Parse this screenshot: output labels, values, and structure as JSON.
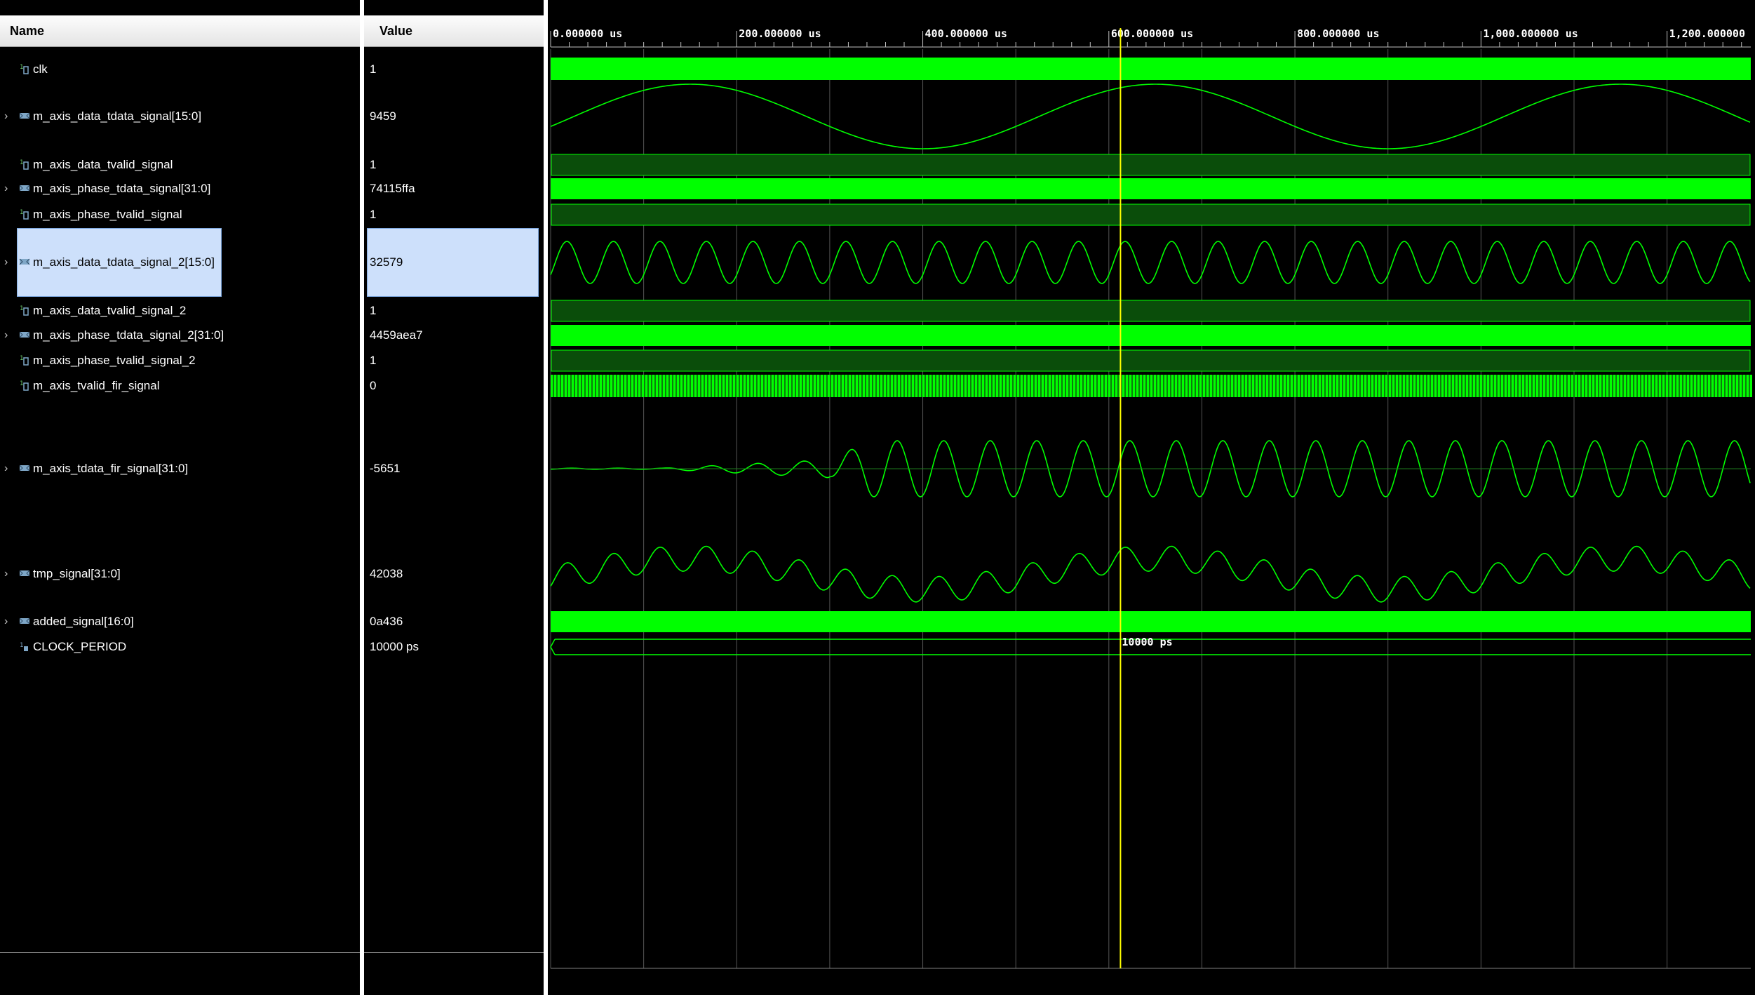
{
  "names_header": "Name",
  "values_header": "Value",
  "signals": [
    {
      "name": "clk",
      "value": "1",
      "kind": "bit",
      "expandable": false,
      "icon": "bit-signal-icon"
    },
    {
      "name": "m_axis_data_tdata_signal[15:0]",
      "value": "9459",
      "kind": "bus",
      "expandable": true,
      "icon": "bus-signal-icon"
    },
    {
      "name": "m_axis_data_tvalid_signal",
      "value": "1",
      "kind": "bit",
      "expandable": false,
      "icon": "bit-signal-icon"
    },
    {
      "name": "m_axis_phase_tdata_signal[31:0]",
      "value": "74115ffa",
      "kind": "bus",
      "expandable": true,
      "icon": "bus-signal-icon"
    },
    {
      "name": "m_axis_phase_tvalid_signal",
      "value": "1",
      "kind": "bit",
      "expandable": false,
      "icon": "bit-signal-icon"
    },
    {
      "name": "m_axis_data_tdata_signal_2[15:0]",
      "value": "32579",
      "kind": "bus",
      "expandable": true,
      "selected": true,
      "icon": "bus-signal-icon"
    },
    {
      "name": "m_axis_data_tvalid_signal_2",
      "value": "1",
      "kind": "bit",
      "expandable": false,
      "icon": "bit-signal-icon"
    },
    {
      "name": "m_axis_phase_tdata_signal_2[31:0]",
      "value": "4459aea7",
      "kind": "bus",
      "expandable": true,
      "icon": "bus-signal-icon"
    },
    {
      "name": "m_axis_phase_tvalid_signal_2",
      "value": "1",
      "kind": "bit",
      "expandable": false,
      "icon": "bit-signal-icon"
    },
    {
      "name": "m_axis_tvalid_fir_signal",
      "value": "0",
      "kind": "bit",
      "expandable": false,
      "icon": "bit-signal-icon"
    },
    {
      "name": "m_axis_tdata_fir_signal[31:0]",
      "value": "-5651",
      "kind": "bus",
      "expandable": true,
      "icon": "bus-signal-icon"
    },
    {
      "name": "tmp_signal[31:0]",
      "value": "42038",
      "kind": "bus",
      "expandable": true,
      "icon": "bus-signal-icon"
    },
    {
      "name": "added_signal[16:0]",
      "value": "0a436",
      "kind": "bus",
      "expandable": true,
      "icon": "bus-signal-icon"
    },
    {
      "name": "CLOCK_PERIOD",
      "value": "10000 ps",
      "kind": "param",
      "expandable": false,
      "icon": "parameter-icon"
    }
  ],
  "timeline": {
    "unit": "us",
    "major_ticks": [
      "0.000000 us",
      "200.000000 us",
      "400.000000 us",
      "600.000000 us",
      "800.000000 us",
      "1,000.000000 us",
      "1,200.000000"
    ],
    "major_tick_values_us": [
      0,
      200,
      400,
      600,
      800,
      1000,
      1200
    ],
    "range_us": [
      0,
      1290
    ],
    "cursor_us": 612.5
  },
  "bus_labels": {
    "clock_period": "10000 ps"
  },
  "colors": {
    "wave": "#00ff00",
    "wave_dim": "#0a4d0a",
    "cursor": "#ffff00",
    "grid": "#555555",
    "selection": "#cde0fb"
  }
}
